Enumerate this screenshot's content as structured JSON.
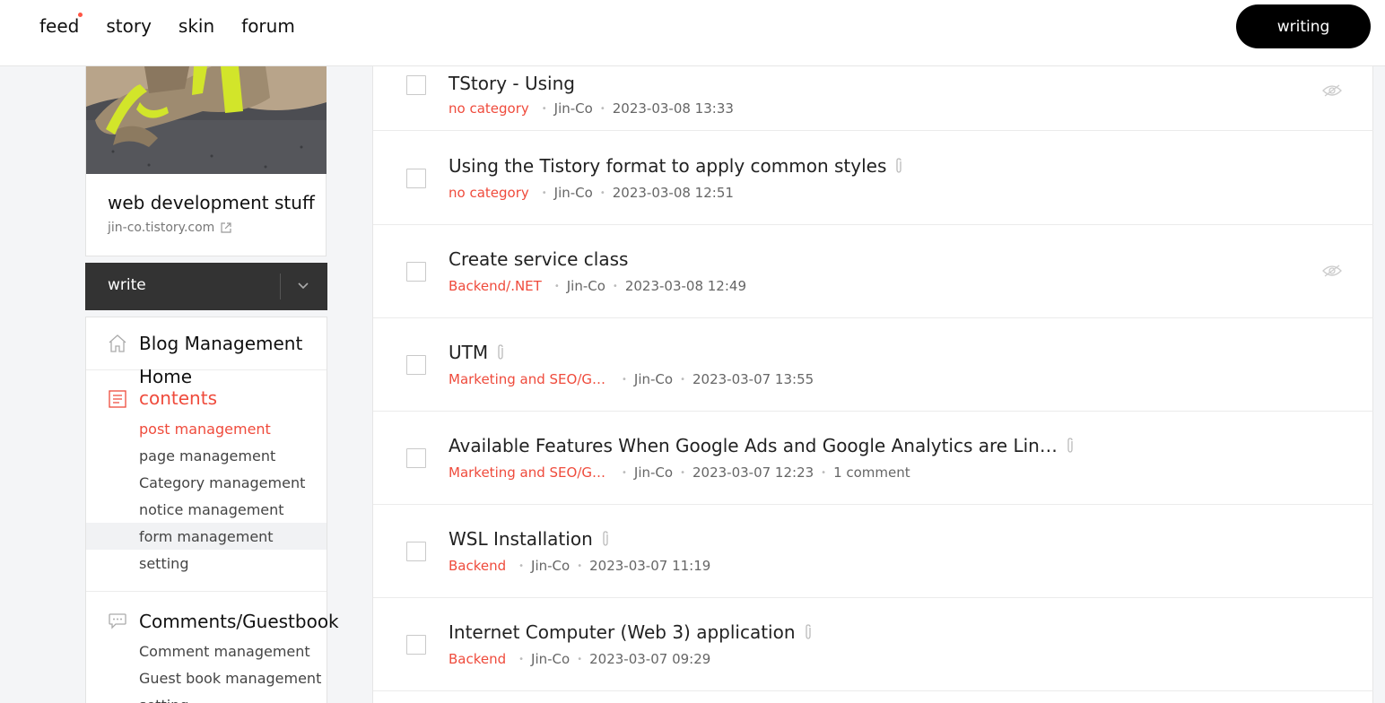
{
  "topnav": {
    "feed": "feed",
    "story": "story",
    "skin": "skin",
    "forum": "forum",
    "writing_button": "writing"
  },
  "profile": {
    "blog_title": "web development stuff",
    "blog_url": "jin-co.tistory.com"
  },
  "write_bar": {
    "label": "write"
  },
  "menu": {
    "blog_management": "Blog Management",
    "home": "Home",
    "contents": "contents",
    "contents_items": [
      "post management",
      "page management",
      "Category management",
      "notice management",
      "form management",
      "setting"
    ],
    "comments": "Comments/Guestbook",
    "comments_items": [
      "Comment management",
      "Guest book management",
      "setting"
    ]
  },
  "posts": [
    {
      "title": "TStory - Using",
      "category": "no category",
      "author": "Jin-Co",
      "date": "2023-03-08 13:33",
      "comments": ""
    },
    {
      "title": "Using the Tistory format to apply common styles",
      "category": "no category",
      "author": "Jin-Co",
      "date": "2023-03-08 12:51",
      "comments": ""
    },
    {
      "title": "Create service class",
      "category": "Backend/.NET",
      "author": "Jin-Co",
      "date": "2023-03-08 12:49",
      "comments": ""
    },
    {
      "title": "UTM",
      "category": "Marketing and SEO/G…",
      "author": "Jin-Co",
      "date": "2023-03-07 13:55",
      "comments": ""
    },
    {
      "title": "Available Features When Google Ads and Google Analytics are Lin…",
      "category": "Marketing and SEO/G…",
      "author": "Jin-Co",
      "date": "2023-03-07 12:23",
      "comments": "1 comment"
    },
    {
      "title": "WSL Installation",
      "category": "Backend",
      "author": "Jin-Co",
      "date": "2023-03-07 11:19",
      "comments": ""
    },
    {
      "title": "Internet Computer (Web 3) application",
      "category": "Backend",
      "author": "Jin-Co",
      "date": "2023-03-07 09:29",
      "comments": ""
    }
  ],
  "colors": {
    "accent": "#ef4b3c",
    "dark_button": "#000000",
    "write_bar": "#333333"
  },
  "icons": {
    "home": "home-icon",
    "contents": "document-icon",
    "comments": "speech-bubble-icon",
    "attachment": "paperclip-icon",
    "private": "eye-slash-icon",
    "external": "external-link-icon",
    "dropdown": "chevron-down-icon"
  }
}
